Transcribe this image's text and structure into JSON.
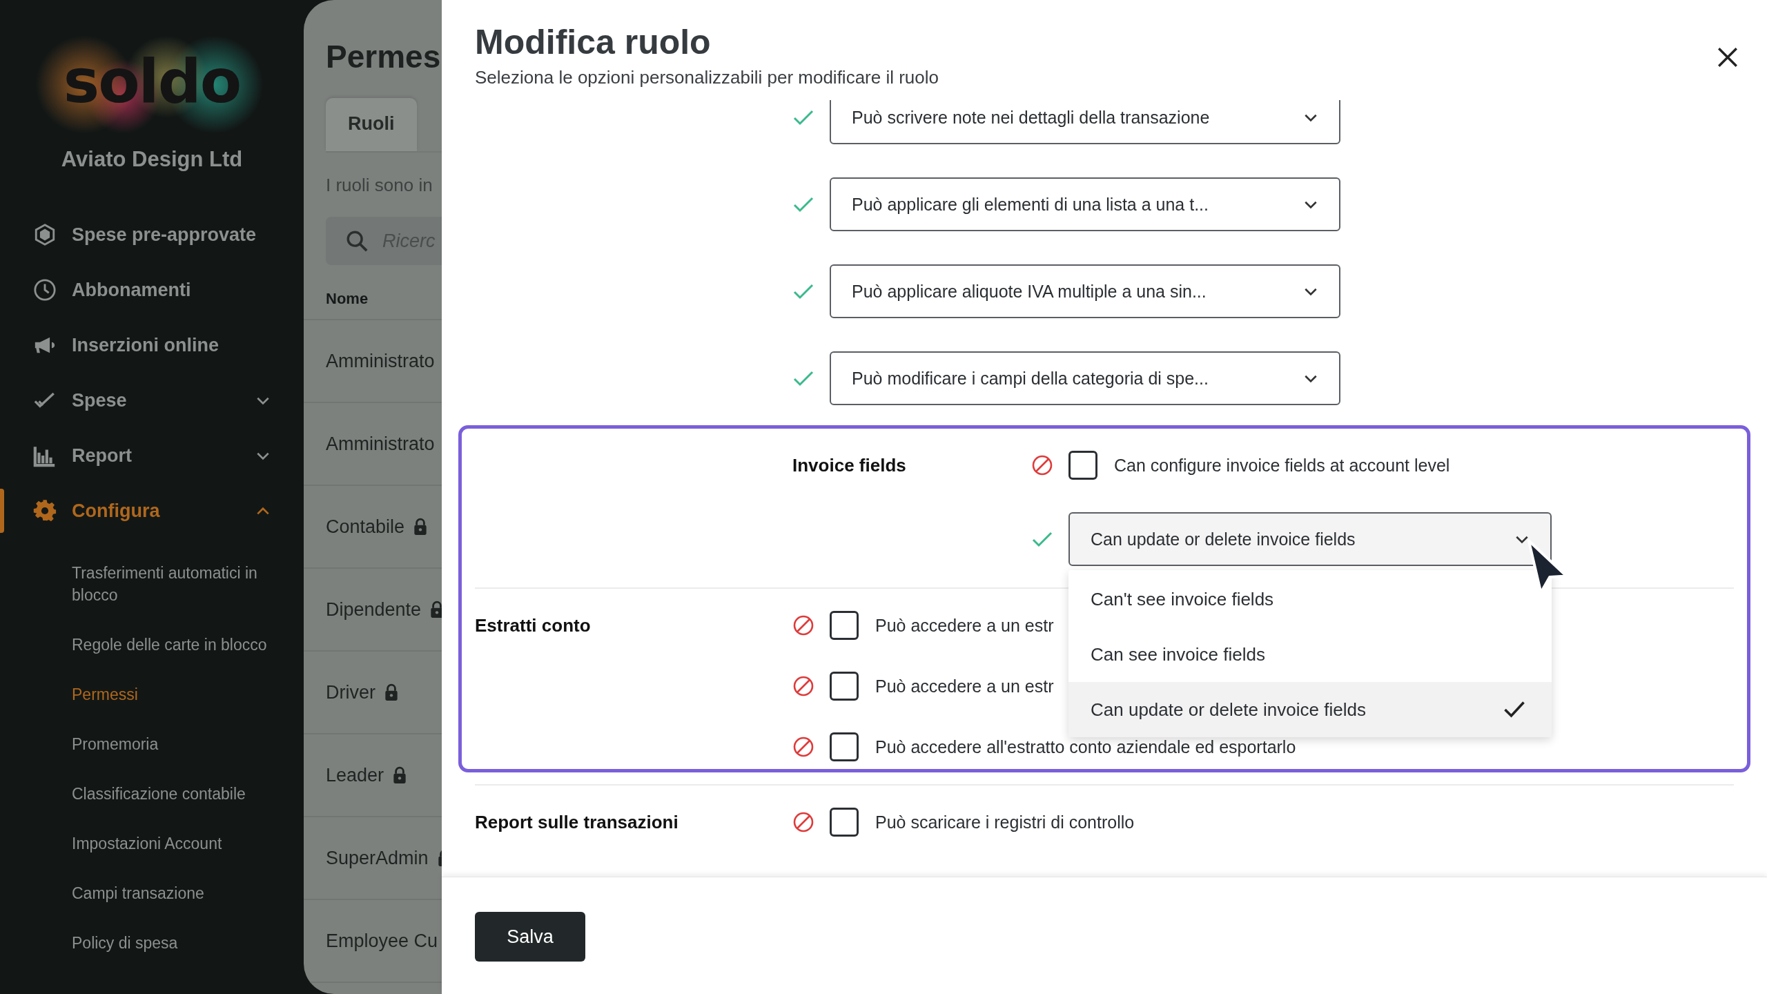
{
  "sidebar": {
    "logo": "soldo",
    "company": "Aviato Design Ltd",
    "items": [
      {
        "label": "Spese pre-approvate",
        "selected": false
      },
      {
        "label": "Abbonamenti",
        "selected": false
      },
      {
        "label": "Inserzioni online",
        "selected": false
      },
      {
        "label": "Spese",
        "selected": false,
        "expanded": false
      },
      {
        "label": "Report",
        "selected": false,
        "expanded": false
      },
      {
        "label": "Configura",
        "selected": true,
        "expanded": true,
        "children": [
          {
            "label": "Trasferimenti automatici in blocco",
            "selected": false
          },
          {
            "label": "Regole delle carte in blocco",
            "selected": false
          },
          {
            "label": "Permessi",
            "selected": true
          },
          {
            "label": "Promemoria",
            "selected": false
          },
          {
            "label": "Classificazione contabile",
            "selected": false
          },
          {
            "label": "Impostazioni Account",
            "selected": false
          },
          {
            "label": "Campi transazione",
            "selected": false
          },
          {
            "label": "Policy di spesa",
            "selected": false
          }
        ]
      }
    ]
  },
  "background_page": {
    "title": "Permes",
    "tabs": [
      {
        "label": "Ruoli",
        "selected": true
      }
    ],
    "intro": "I ruoli sono in",
    "search": {
      "placeholder": "Ricerc"
    },
    "table": {
      "columns": [
        "Nome"
      ],
      "rows": [
        {
          "name": "Amministrato",
          "locked": false
        },
        {
          "name": "Amministrato",
          "locked": false
        },
        {
          "name": "Contabile",
          "locked": true
        },
        {
          "name": "Dipendente",
          "locked": true
        },
        {
          "name": "Driver",
          "locked": true
        },
        {
          "name": "Leader",
          "locked": true
        },
        {
          "name": "SuperAdmin",
          "locked": true
        },
        {
          "name": "Employee Cu",
          "locked": false
        }
      ]
    }
  },
  "modal": {
    "title": "Modifica ruolo",
    "subtitle": "Seleziona le opzioni personalizzabili per modificare il ruolo",
    "blocks": [
      {
        "highlighted": false,
        "sections": [
          {
            "permissions": [
              {
                "kind": "dropdown",
                "allowed": true,
                "value": "Può scrivere note nei dettagli della transazione",
                "expanded": false
              },
              {
                "kind": "dropdown",
                "allowed": true,
                "value": "Può applicare gli elementi di una lista a una t...",
                "expanded": false
              },
              {
                "kind": "dropdown",
                "allowed": true,
                "value": "Può applicare aliquote IVA multiple a una sin...",
                "expanded": false
              },
              {
                "kind": "dropdown",
                "allowed": true,
                "value": "Può modificare i campi della categoria di spe...",
                "expanded": false
              }
            ]
          }
        ]
      },
      {
        "highlighted": true,
        "sections": [
          {
            "permissions": [
              {
                "kind": "group",
                "label": "Invoice fields",
                "permissions": [
                  {
                    "kind": "checkbox",
                    "allowed": false,
                    "checked": false,
                    "text": "Can configure invoice fields at account level"
                  },
                  {
                    "kind": "dropdown",
                    "allowed": true,
                    "value": "Can update or delete invoice fields",
                    "expanded": true,
                    "options": [
                      {
                        "label": "Can't see invoice fields",
                        "selected": false
                      },
                      {
                        "label": "Can see invoice fields",
                        "selected": false
                      },
                      {
                        "label": "Can update or delete invoice fields",
                        "selected": true
                      }
                    ]
                  }
                ]
              }
            ]
          },
          {
            "label": "Estratti conto",
            "permissions": [
              {
                "kind": "checkbox",
                "allowed": false,
                "checked": false,
                "text": "Può accedere a un estr"
              },
              {
                "kind": "checkbox",
                "allowed": false,
                "checked": false,
                "text": "Può accedere a un estr"
              },
              {
                "kind": "checkbox",
                "allowed": false,
                "checked": false,
                "text": "Può accedere all'estratto conto aziendale ed esportarlo"
              }
            ]
          }
        ]
      },
      {
        "highlighted": false,
        "sections": [
          {
            "label": "Report sulle transazioni",
            "permissions": [
              {
                "kind": "checkbox",
                "allowed": false,
                "checked": false,
                "text": "Può scaricare i registri di controllo"
              }
            ]
          }
        ]
      }
    ],
    "save": "Salva"
  }
}
